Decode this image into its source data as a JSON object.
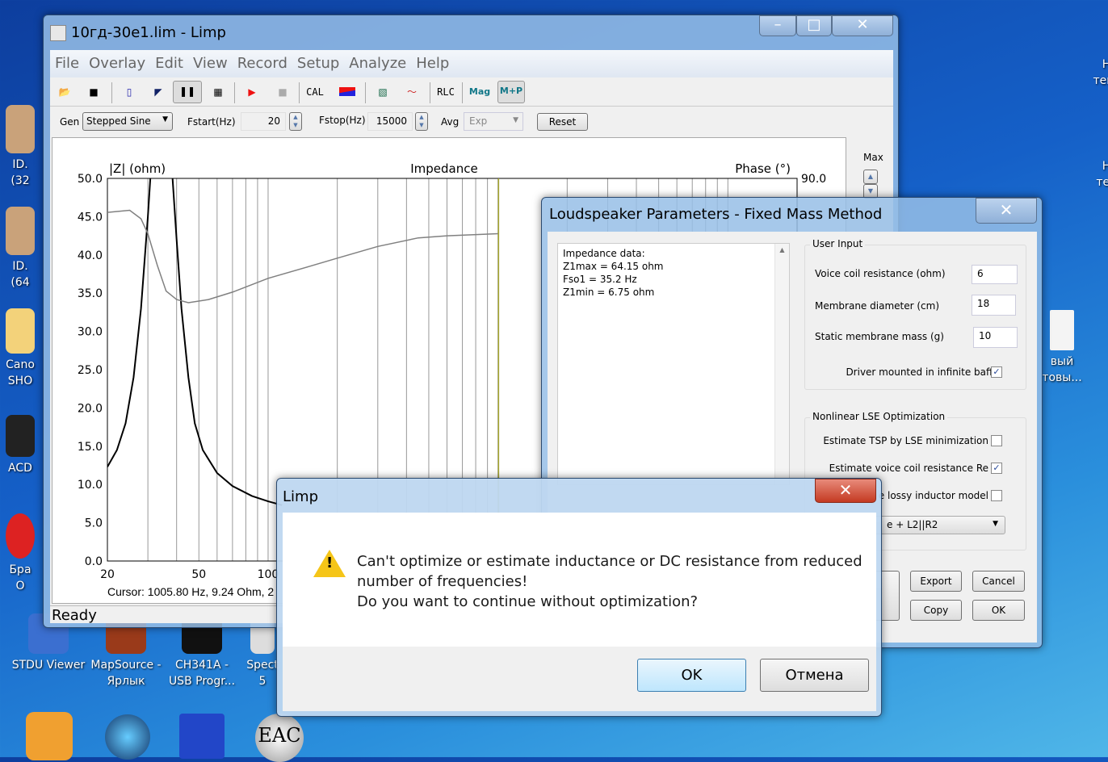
{
  "desktop": {
    "icons": [
      {
        "label": "ID.\n(32"
      },
      {
        "label": "ID.\n(64"
      },
      {
        "label": "Cano\nSHO"
      },
      {
        "label": "ACD"
      },
      {
        "label": "Бра\nO"
      },
      {
        "label": "STDU Viewer"
      },
      {
        "label": "MapSource -\nЯрлык"
      },
      {
        "label": "CH341A -\nUSB Progr..."
      },
      {
        "label": "Spect\n5"
      },
      {
        "label": "Н\nтекс"
      },
      {
        "label": "Н\nтек"
      },
      {
        "label": "вый\nтовы..."
      },
      {
        "label": "EAC"
      }
    ]
  },
  "main_window": {
    "title": "10гд-30е1.lim - Limp",
    "menu": [
      "File",
      "Overlay",
      "Edit",
      "View",
      "Record",
      "Setup",
      "Analyze",
      "Help"
    ],
    "toolbar": {
      "cal": "CAL",
      "rlc": "RLC",
      "mag": "Mag",
      "mp": "M+P"
    },
    "controls": {
      "gen_label": "Gen",
      "gen_value": "Stepped Sine",
      "fstart_label": "Fstart(Hz)",
      "fstart_value": "20",
      "fstop_label": "Fstop(Hz)",
      "fstop_value": "15000",
      "avg_label": "Avg",
      "avg_value": "Exp",
      "reset": "Reset"
    },
    "side_panel": {
      "max_label": "Max"
    },
    "cursor_text": "Cursor: 1005.80 Hz, 9.24 Ohm, 2",
    "status": "Ready"
  },
  "chart_data": {
    "type": "line",
    "title": "Impedance",
    "ylabel": "|Z| (ohm)",
    "y2label": "Phase (°)",
    "xscale": "log",
    "xlim": [
      20,
      20000
    ],
    "ylim": [
      0,
      50
    ],
    "y2lim": [
      -90,
      90
    ],
    "yticks": [
      "50.0",
      "45.0",
      "40.0",
      "35.0",
      "30.0",
      "25.0",
      "20.0",
      "15.0",
      "10.0",
      "5.0",
      "0.0"
    ],
    "y2ticks_visible": [
      "90.0"
    ],
    "xticks_visible": [
      "20",
      "50",
      "100"
    ],
    "grid": true,
    "cursor_hz": 1005.8,
    "series": [
      {
        "name": "Impedance",
        "color": "#000000",
        "axis": "y",
        "x": [
          20,
          22,
          24,
          26,
          28,
          30,
          31.5,
          35,
          38,
          40,
          42,
          45,
          48,
          52,
          60,
          70,
          85,
          100,
          115
        ],
        "y": [
          12.3,
          14.5,
          18,
          24,
          33,
          45,
          55,
          64.15,
          52,
          42,
          33,
          24,
          18,
          14.5,
          11.5,
          9.8,
          8.5,
          7.8,
          7.3
        ]
      },
      {
        "name": "Phase",
        "color": "#808080",
        "axis": "y2",
        "x": [
          20,
          25,
          28,
          30,
          33,
          36,
          40,
          45,
          55,
          70,
          100,
          150,
          200,
          300,
          450,
          600,
          1000
        ],
        "y": [
          74,
          75,
          71,
          64,
          49,
          37,
          33,
          31.5,
          33,
          36.5,
          43,
          48.5,
          52.5,
          58,
          62,
          63,
          64
        ]
      }
    ]
  },
  "ls_dialog": {
    "title": "Loudspeaker Parameters - Fixed Mass Method",
    "impedance_lines": [
      "Impedance data:",
      "Z1max =  64.15 ohm",
      "Fso1 = 35.2 Hz",
      "Z1min = 6.75 ohm"
    ],
    "user_input": {
      "title": "User Input",
      "vc_label": "Voice coil resistance (ohm)",
      "vc_value": "6",
      "diam_label": "Membrane diameter (cm)",
      "diam_value": "18",
      "mass_label": "Static membrane mass (g)",
      "mass_value": "10",
      "baffle_label": "Driver mounted in infinite baffle",
      "baffle_checked": true
    },
    "nonlinear": {
      "title": "Nonlinear LSE Optimization",
      "tsp_label": "Estimate TSP by LSE minimization",
      "tsp_checked": false,
      "re_label": "Estimate voice coil resistance Re",
      "re_checked": true,
      "lossy_label": "e lossy inductor model",
      "lossy_checked": false,
      "model_value": "e + L2||R2"
    },
    "buttons": {
      "export": "Export",
      "cancel": "Cancel",
      "copy": "Copy",
      "ok": "OK"
    }
  },
  "msgbox": {
    "title": "Limp",
    "line1": "Can't optimize or estimate inductance or DC resistance from reduced",
    "line2": "number of frequencies!",
    "line3": "Do you want to continue without optimization?",
    "ok": "OK",
    "cancel": "Отмена"
  }
}
